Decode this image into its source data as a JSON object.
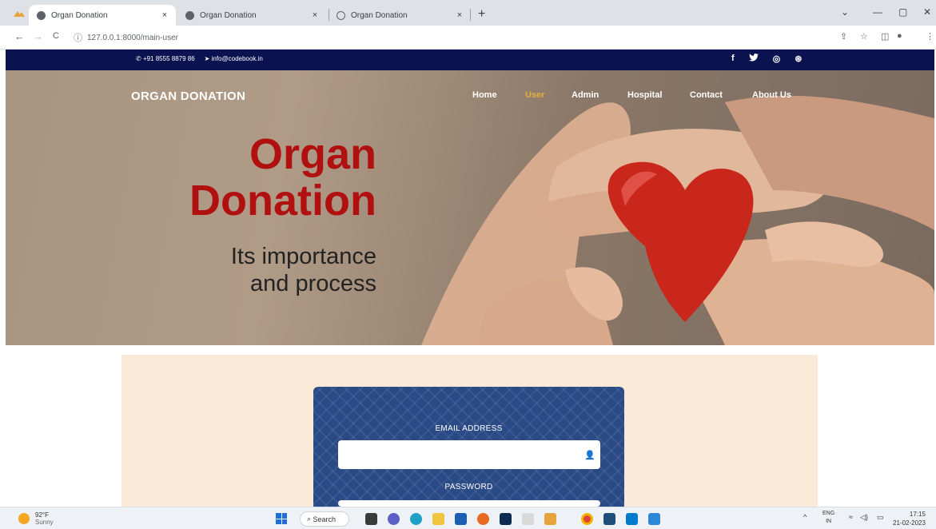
{
  "browser": {
    "tabs": [
      {
        "title": "Organ Donation",
        "active": true
      },
      {
        "title": "Organ Donation",
        "active": false
      },
      {
        "title": "Organ Donation",
        "active": false
      }
    ],
    "close_glyph": "×",
    "new_tab_glyph": "+",
    "url": "127.0.0.1:8000/main-user",
    "nav": {
      "back": "←",
      "forward": "→",
      "reload": "C"
    },
    "window": {
      "dropdown": "⌄",
      "minimize": "—",
      "restore": "▢",
      "close": "✕"
    },
    "toolbar_icons": {
      "share": "⇪",
      "bookmark": "☆",
      "sidepanel": "◫",
      "profile": "●",
      "menu": "⋮"
    }
  },
  "site": {
    "contact": {
      "phone": "+91 8555 8879 86",
      "email": "info@codebook.in"
    },
    "social": [
      {
        "name": "facebook-icon",
        "glyph": "f"
      },
      {
        "name": "twitter-icon",
        "glyph": "♥"
      },
      {
        "name": "instagram-icon",
        "glyph": "◎"
      },
      {
        "name": "dribbble-icon",
        "glyph": "⊛"
      }
    ],
    "brand": "ORGAN DONATION",
    "nav": [
      {
        "label": "Home",
        "active": false
      },
      {
        "label": "User",
        "active": true
      },
      {
        "label": "Admin",
        "active": false
      },
      {
        "label": "Hospital",
        "active": false
      },
      {
        "label": "Contact",
        "active": false
      },
      {
        "label": "About Us",
        "active": false
      }
    ],
    "hero": {
      "title_line1": "Organ",
      "title_line2": "Donation",
      "subtitle_line1": "Its importance",
      "subtitle_line2": "and process"
    },
    "login": {
      "email_label": "EMAIL ADDRESS",
      "email_value": "",
      "password_label": "PASSWORD",
      "password_value": ""
    }
  },
  "colors": {
    "topbar": "#0b1250",
    "accent": "#b01010",
    "nav_active": "#e0b040",
    "card": "#2a4a86",
    "panel": "#fbead8"
  },
  "taskbar": {
    "weather_temp": "92°F",
    "weather_desc": "Sunny",
    "search": "Search",
    "tray": {
      "chevron": "^",
      "lang": "ENG",
      "region": "IN",
      "wifi": "≈",
      "volume": "◁)",
      "battery": "▭"
    },
    "time": "17:15",
    "date": "21-02-2023"
  }
}
